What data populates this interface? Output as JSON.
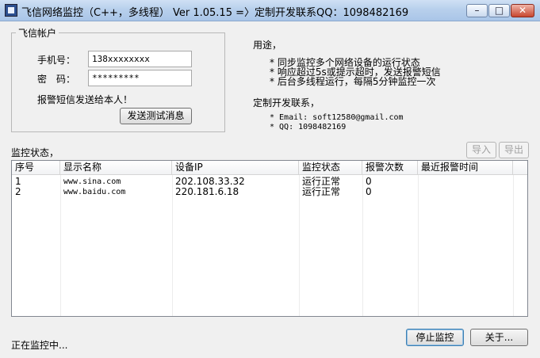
{
  "window": {
    "title": "飞信网络监控（C++，多线程） Ver 1.05.15 =〉定制开发联系QQ：1098482169",
    "buttons": {
      "minimize": "–",
      "maximize": "□",
      "close": "✕"
    }
  },
  "account": {
    "group_label": "飞信帐户",
    "phone_label": "手机号：",
    "phone_value": "138xxxxxxxx",
    "password_label": "密　码：",
    "password_value": "*********",
    "notice": "报警短信发送给本人！",
    "test_button": "发送测试消息"
  },
  "usage": {
    "title": "用途，",
    "items": [
      "* 同步监控多个网络设备的运行状态",
      "* 响应超过5s或提示超时，发送报警短信",
      "* 后台多线程运行，每隔5分钟监控一次"
    ],
    "contact_title": "定制开发联系，",
    "contacts": [
      "* Email: soft12580@gmail.com",
      "* QQ: 1098482169"
    ]
  },
  "monitor": {
    "label": "监控状态，",
    "import_button": "导入",
    "export_button": "导出",
    "columns": [
      "序号",
      "显示名称",
      "设备IP",
      "监控状态",
      "报警次数",
      "最近报警时间"
    ],
    "rows": [
      [
        "1",
        "www.sina.com",
        "202.108.33.32",
        "运行正常",
        "0",
        ""
      ],
      [
        "2",
        "www.baidu.com",
        "220.181.6.18",
        "运行正常",
        "0",
        ""
      ]
    ]
  },
  "status": {
    "text": "正在监控中...",
    "stop_button": "停止监控",
    "about_button": "关于..."
  }
}
